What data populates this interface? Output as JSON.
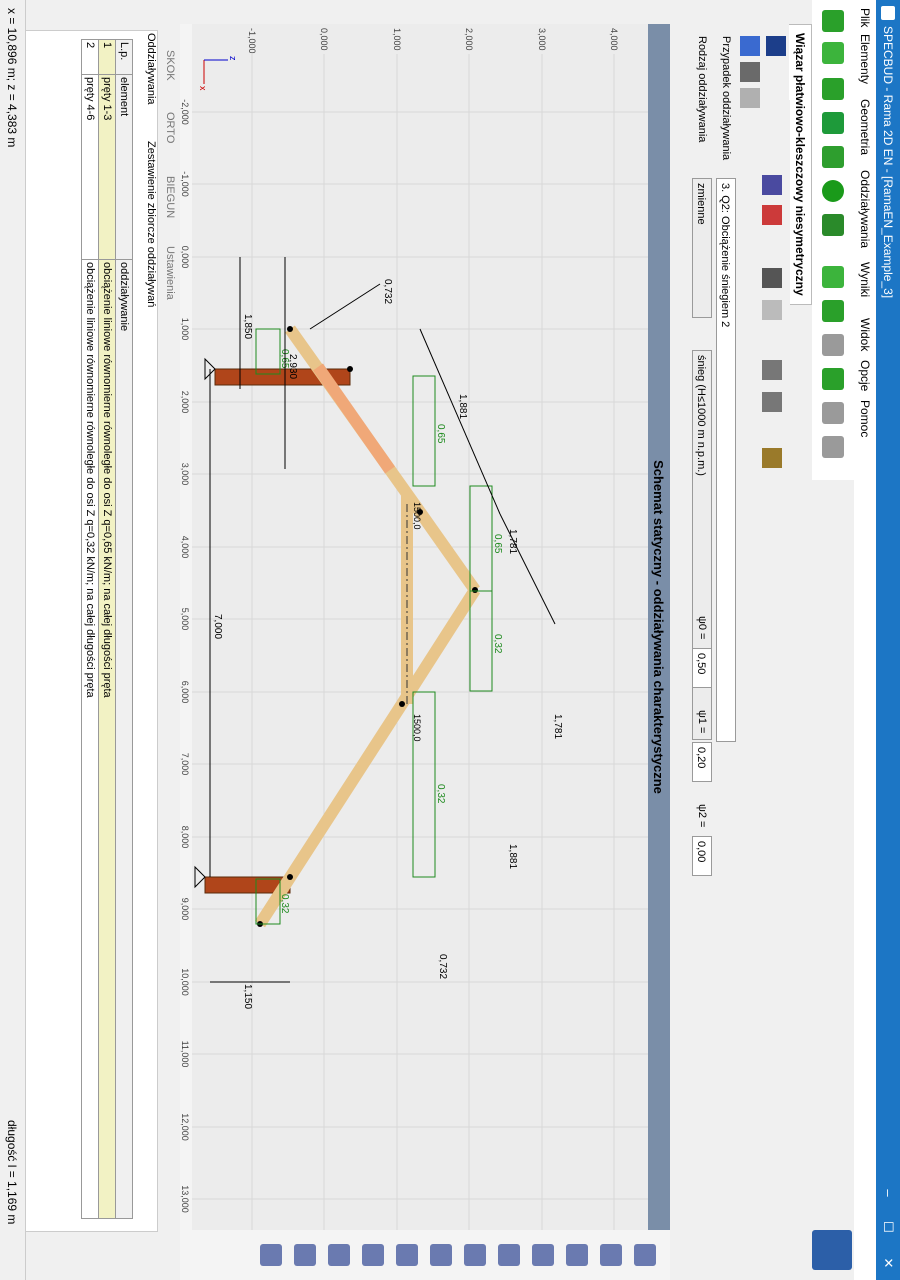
{
  "app": {
    "title": "SPECBUD - Rama 2D EN - [RamaEN_Example_3]",
    "minimize": "–",
    "maximize": "☐",
    "close": "✕"
  },
  "menu": [
    "Plik",
    "Elementy",
    "Geometria",
    "Oddziaływania",
    "Wyniki",
    "Widok",
    "Opcje",
    "Pomoc"
  ],
  "structure_title": "Wiązar płatwiowo-kleszczowy niesymetryczny",
  "props": {
    "case_label": "Przypadek oddziaływania",
    "case_value": "3.   Q2:  Obciążenie śniegiem 2",
    "type_label": "Rodzaj oddziaływania",
    "type_value": "zmienne",
    "snow_value": "śnieg (H≤1000 m n.p.m.)",
    "psi0_label": "ψ0 =",
    "psi0_value": "0,50",
    "psi1_label": "ψ1 =",
    "psi1_value": "0,20",
    "psi2_label": "ψ2 =",
    "psi2_value": "0,00"
  },
  "drawing": {
    "title": "Schemat statyczny - oddziaływania charakterystyczne",
    "x_ticks": [
      "-2,000",
      "-1,000",
      "0,000",
      "1,000",
      "2,000",
      "3,000",
      "4,000",
      "5,000",
      "6,000",
      "7,000",
      "8,000",
      "9,000",
      "10,000",
      "11,000",
      "12,000",
      "13,000"
    ],
    "z_ticks": [
      "-1,000",
      "0,000",
      "1,000",
      "2,000",
      "3,000",
      "4,000"
    ],
    "dims": {
      "d1850": "1,850",
      "d2930": "2,930",
      "d7000": "7,000",
      "d1150": "1,150",
      "d0732a": "0,732",
      "d1881": "1,881",
      "d1781a": "1,781",
      "d1781b": "1,781",
      "d1881b": "1,881",
      "d0732b": "0,732"
    },
    "loads": {
      "l1": "0,65",
      "l2": "0,65",
      "l3": "0,65",
      "l4": "0,32",
      "l5": "0,32",
      "l6": "0,32"
    },
    "post_labels": {
      "p1": "1500,0",
      "p2": "1500,0"
    },
    "axis_x": "x",
    "axis_z": "z"
  },
  "view_tabs": [
    "SKOK",
    "ORTO",
    "BIEGUN",
    "Ustawienia"
  ],
  "panel": {
    "tab1": "Oddziaływania",
    "tab2": "Zestawienie zbiorcze oddziaływań",
    "headers": [
      "L.p.",
      "element",
      "oddziaływanie"
    ],
    "rows": [
      [
        "1",
        "pręty 1-3",
        "obciążenie liniowe równomierne równoległe do osi Z q=0,65 kN/m; na całej długości pręta"
      ],
      [
        "2",
        "pręty 4-6",
        "obciążenie liniowe równomierne równoległe do osi Z q=0,32 kN/m; na całej długości pręta"
      ]
    ]
  },
  "status": {
    "coords": "x = 10,896 m;  z = 4,383 m",
    "length": "długość l = 1,169 m"
  },
  "colors": {
    "titlebar": "#1c76c5",
    "beam": "#e8c58a",
    "selected_beam": "#f0a878",
    "support": "#b0451a",
    "load": "#1e8a1e",
    "drawing_bg": "#ececec"
  }
}
